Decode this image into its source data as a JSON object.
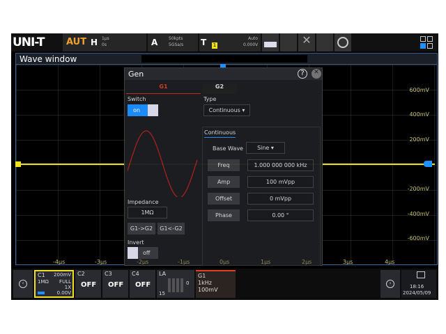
{
  "brand": "UNI-T",
  "mode": "AUTO",
  "horizontal": {
    "label": "H",
    "scale": "1μs",
    "offset": "0s"
  },
  "acquire": {
    "label": "A",
    "points": "50kpts",
    "rate": "5GSa/s"
  },
  "trigger": {
    "label": "T",
    "channel": "1",
    "mode": "Auto",
    "level": "0.000V"
  },
  "wave_window": {
    "title": "Wave window"
  },
  "volt_labels": [
    "600mV",
    "400mV",
    "200mV",
    "-200mV",
    "-400mV",
    "-600mV"
  ],
  "time_labels": [
    "-4μs",
    "-3μs",
    "-2μs",
    "-1μs",
    "0μs",
    "1μs",
    "2μs",
    "3μs",
    "4μs"
  ],
  "gen": {
    "title": "Gen",
    "tabs": [
      "G1",
      "G2"
    ],
    "switch_label": "Switch",
    "switch_value": "on",
    "type_label": "Type",
    "type_value": "Continuous",
    "section": "Continuous",
    "base_wave_label": "Base Wave",
    "base_wave_value": "Sine",
    "params": [
      {
        "label": "Freq",
        "value": "1.000 000 000 kHz"
      },
      {
        "label": "Amp",
        "value": "100 mVpp"
      },
      {
        "label": "Offset",
        "value": "0 mVpp"
      },
      {
        "label": "Phase",
        "value": "0.00 °"
      }
    ],
    "impedance_label": "Impedance",
    "impedance_value": "1MΩ",
    "copy_to_g2": "G1->G2",
    "copy_to_g1": "G1<-G2",
    "invert_label": "Invert",
    "invert_value": "off",
    "wave_color": "#b02020"
  },
  "channels": {
    "c1": {
      "name": "C1",
      "scale": "200mV",
      "impedance": "1MΩ",
      "bw": "FULL",
      "probe": "1X",
      "offset": "0.00V"
    },
    "c2": {
      "name": "C2",
      "state": "OFF"
    },
    "c3": {
      "name": "C3",
      "state": "OFF"
    },
    "c4": {
      "name": "C4",
      "state": "OFF"
    },
    "la": {
      "name": "LA",
      "hi": "0",
      "lo": "15"
    },
    "g1": {
      "name": "G1",
      "freq": "1kHz",
      "amp": "100mV"
    }
  },
  "clock": {
    "time": "18:16",
    "date": "2024/05/09"
  },
  "colors": {
    "ch1": "#f0e020",
    "accent": "#1e90ff",
    "g1": "#e04020"
  }
}
